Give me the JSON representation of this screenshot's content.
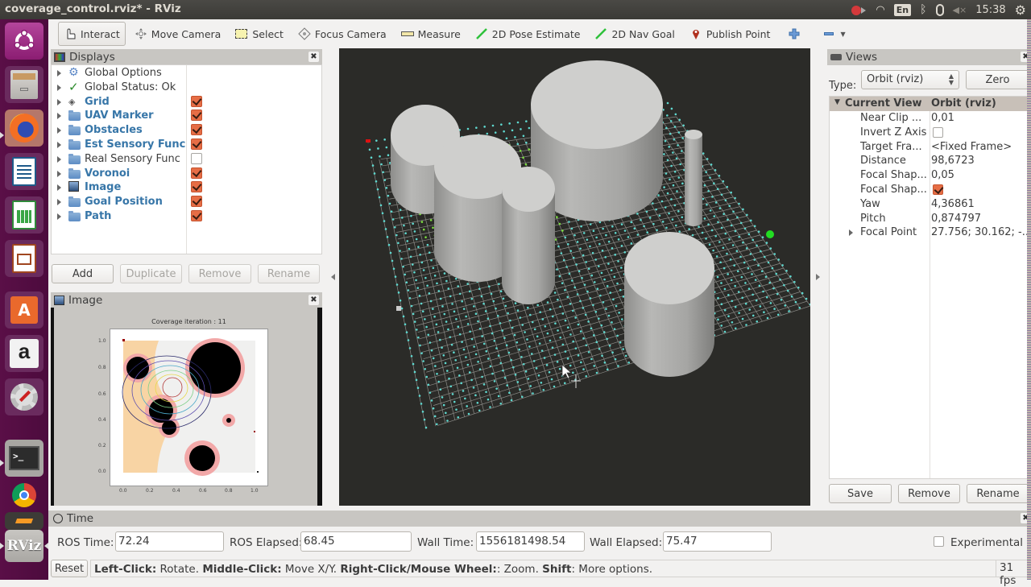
{
  "window": {
    "title": "coverage_control.rviz* - RViz"
  },
  "system_tray": {
    "keyboard_layout": "En",
    "clock": "15:38",
    "icons": [
      "record-icon",
      "wifi-icon",
      "bluetooth-icon",
      "mouse-icon",
      "volume-muted-icon",
      "power-icon"
    ]
  },
  "launcher": {
    "apps": [
      {
        "name": "ubuntu-dash",
        "icon": "ubuntu-logo-icon"
      },
      {
        "name": "files",
        "icon": "file-cabinet-icon"
      },
      {
        "name": "firefox",
        "icon": "firefox-icon"
      },
      {
        "name": "libreoffice-writer",
        "icon": "writer-icon"
      },
      {
        "name": "libreoffice-calc",
        "icon": "calc-icon"
      },
      {
        "name": "libreoffice-impress",
        "icon": "impress-icon"
      },
      {
        "name": "software-center",
        "icon": "shopping-bag-icon"
      },
      {
        "name": "amazon",
        "icon": "amazon-icon"
      },
      {
        "name": "system-settings",
        "icon": "settings-wrench-icon"
      },
      {
        "name": "terminal",
        "icon": "terminal-icon"
      },
      {
        "name": "chrome",
        "icon": "chrome-icon"
      },
      {
        "name": "sublime",
        "icon": "sublime-icon"
      },
      {
        "name": "rviz",
        "icon": "rviz-icon",
        "label": "RViz"
      }
    ]
  },
  "toolbar": {
    "tools": [
      {
        "label": "Interact",
        "icon": "hand-pointer-icon",
        "active": true
      },
      {
        "label": "Move Camera",
        "icon": "move-camera-icon",
        "active": false
      },
      {
        "label": "Select",
        "icon": "select-rect-icon",
        "active": false
      },
      {
        "label": "Focus Camera",
        "icon": "focus-camera-icon",
        "active": false
      },
      {
        "label": "Measure",
        "icon": "ruler-icon",
        "active": false
      },
      {
        "label": "2D Pose Estimate",
        "icon": "green-arrow-icon",
        "active": false
      },
      {
        "label": "2D Nav Goal",
        "icon": "green-arrow-icon",
        "active": false
      },
      {
        "label": "Publish Point",
        "icon": "map-pin-icon",
        "active": false
      }
    ],
    "add_tool_icon": "plus-icon",
    "remove_tool_icon": "minus-icon"
  },
  "displays": {
    "title": "Displays",
    "items": [
      {
        "label": "Global Options",
        "icon": "gear-icon",
        "checked": null,
        "bold": false
      },
      {
        "label": "Global Status: Ok",
        "icon": "checkmark-icon",
        "checked": null,
        "bold": false
      },
      {
        "label": "Grid",
        "icon": "grid-icon",
        "checked": true,
        "bold": true
      },
      {
        "label": "UAV Marker",
        "icon": "folder-icon",
        "checked": true,
        "bold": true
      },
      {
        "label": "Obstacles",
        "icon": "folder-icon",
        "checked": true,
        "bold": true
      },
      {
        "label": "Est Sensory Func",
        "icon": "folder-icon",
        "checked": true,
        "bold": true
      },
      {
        "label": "Real Sensory Func",
        "icon": "folder-icon",
        "checked": false,
        "bold": false
      },
      {
        "label": "Voronoi",
        "icon": "folder-icon",
        "checked": true,
        "bold": true
      },
      {
        "label": "Image",
        "icon": "image-icon",
        "checked": true,
        "bold": true
      },
      {
        "label": "Goal Position",
        "icon": "folder-icon",
        "checked": true,
        "bold": true
      },
      {
        "label": "Path",
        "icon": "folder-icon",
        "checked": true,
        "bold": true
      }
    ],
    "buttons": {
      "add": "Add",
      "duplicate": "Duplicate",
      "remove": "Remove",
      "rename": "Rename"
    }
  },
  "image_panel": {
    "title": "Image",
    "plot_title": "Coverage iteration : 11",
    "y_ticks": [
      "1.0",
      "0.8",
      "0.6",
      "0.4",
      "0.2",
      "0.0"
    ],
    "x_ticks": [
      "0.0",
      "0.2",
      "0.4",
      "0.6",
      "0.8",
      "1.0"
    ]
  },
  "views": {
    "title": "Views",
    "type_label": "Type:",
    "type_value": "Orbit (rviz)",
    "zero_button": "Zero",
    "current_view": {
      "key": "Current View",
      "value": "Orbit (rviz)"
    },
    "properties": [
      {
        "key": "Near Clip ...",
        "value": "0,01"
      },
      {
        "key": "Invert Z Axis",
        "value": "",
        "checkbox": false
      },
      {
        "key": "Target Fra...",
        "value": "<Fixed Frame>"
      },
      {
        "key": "Distance",
        "value": "98,6723"
      },
      {
        "key": "Focal Shap...",
        "value": "0,05"
      },
      {
        "key": "Focal Shap...",
        "value": "",
        "checkbox": true
      },
      {
        "key": "Yaw",
        "value": "4,36861"
      },
      {
        "key": "Pitch",
        "value": "0,874797"
      },
      {
        "key": "Focal Point",
        "value": "27.756; 30.162; -...",
        "expandable": true
      }
    ],
    "buttons": {
      "save": "Save",
      "remove": "Remove",
      "rename": "Rename"
    }
  },
  "time": {
    "title": "Time",
    "ros_time_label": "ROS Time:",
    "ros_time": "72.24",
    "ros_elapsed_label": "ROS Elapsed:",
    "ros_elapsed": "68.45",
    "wall_time_label": "Wall Time:",
    "wall_time": "1556181498.54",
    "wall_elapsed_label": "Wall Elapsed:",
    "wall_elapsed": "75.47",
    "experimental_label": "Experimental",
    "experimental_checked": false
  },
  "status_bar": {
    "reset_button": "Reset",
    "hints": [
      {
        "key": "Left-Click:",
        "text": " Rotate. "
      },
      {
        "key": "Middle-Click:",
        "text": " Move X/Y. "
      },
      {
        "key": "Right-Click/Mouse Wheel:",
        "text": ": Zoom. "
      },
      {
        "key": "Shift",
        "text": ": More options."
      }
    ],
    "fps": "31 fps"
  },
  "colors": {
    "accent_checkbox": "#e66d45",
    "display_label_blue": "#3776a8",
    "viewport_bg": "#2b2b28",
    "launcher_bg": "#5a0f47"
  }
}
